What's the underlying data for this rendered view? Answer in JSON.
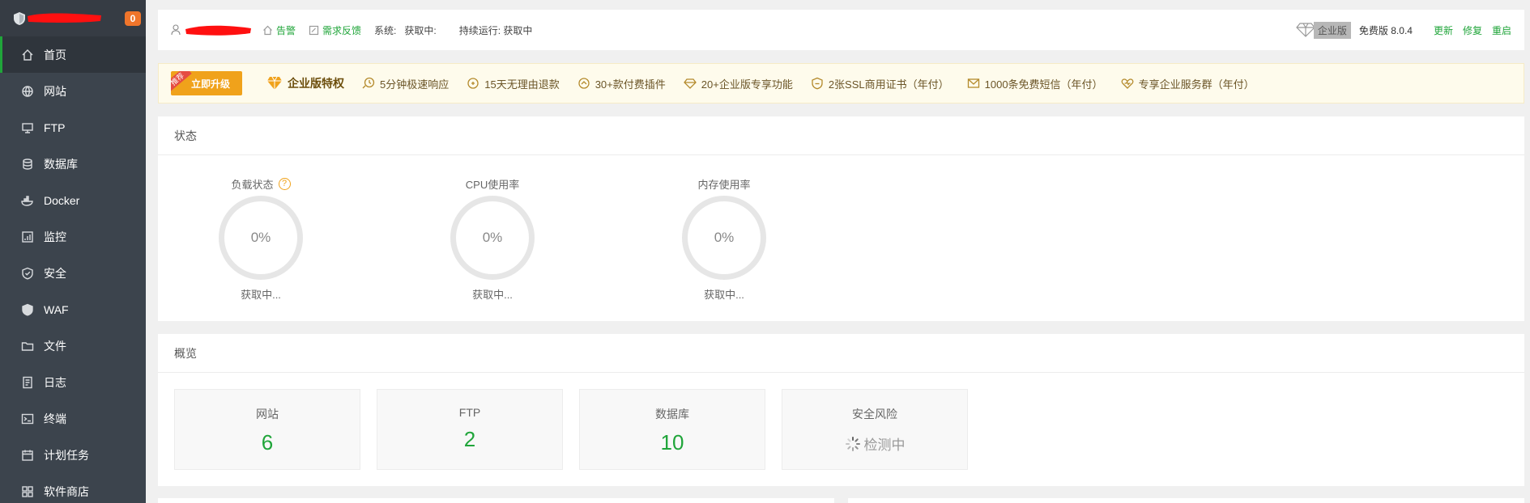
{
  "sidebar": {
    "badge_count": "0",
    "items": [
      {
        "label": "首页",
        "icon": "home-icon",
        "active": true
      },
      {
        "label": "网站",
        "icon": "globe-icon"
      },
      {
        "label": "FTP",
        "icon": "ftp-icon"
      },
      {
        "label": "数据库",
        "icon": "database-icon"
      },
      {
        "label": "Docker",
        "icon": "docker-icon"
      },
      {
        "label": "监控",
        "icon": "monitor-icon"
      },
      {
        "label": "安全",
        "icon": "shield-check-icon"
      },
      {
        "label": "WAF",
        "icon": "waf-shield-icon"
      },
      {
        "label": "文件",
        "icon": "folder-icon"
      },
      {
        "label": "日志",
        "icon": "log-icon"
      },
      {
        "label": "终端",
        "icon": "terminal-icon"
      },
      {
        "label": "计划任务",
        "icon": "calendar-icon"
      },
      {
        "label": "软件商店",
        "icon": "apps-icon"
      }
    ]
  },
  "topbar": {
    "alert_label": "告警",
    "feedback_label": "需求反馈",
    "system_label": "系统:",
    "system_value": "获取中:",
    "uptime_label": "持续运行: 获取中",
    "enterprise_label": "企业版",
    "free_version": "免费版 8.0.4",
    "update_label": "更新",
    "repair_label": "修复",
    "restart_label": "重启"
  },
  "promo": {
    "recommend_tag": "推荐",
    "upgrade_label": "立即升级",
    "privilege_label": "企业版特权",
    "features": [
      {
        "label": "5分钟极速响应",
        "icon": "fast-response-icon"
      },
      {
        "label": "15天无理由退款",
        "icon": "refund-icon"
      },
      {
        "label": "30+款付费插件",
        "icon": "plugin-icon"
      },
      {
        "label": "20+企业版专享功能",
        "icon": "diamond-icon"
      },
      {
        "label": "2张SSL商用证书（年付）",
        "icon": "ssl-icon"
      },
      {
        "label": "1000条免费短信（年付）",
        "icon": "mail-icon"
      },
      {
        "label": "专享企业服务群（年付）",
        "icon": "service-heart-icon"
      }
    ]
  },
  "status": {
    "title": "状态",
    "gauges": [
      {
        "title": "负载状态",
        "value": "0%",
        "state": "获取中...",
        "help": "?"
      },
      {
        "title": "CPU使用率",
        "value": "0%",
        "state": "获取中..."
      },
      {
        "title": "内存使用率",
        "value": "0%",
        "state": "获取中..."
      }
    ]
  },
  "overview": {
    "title": "概览",
    "cards": [
      {
        "label": "网站",
        "value": "6"
      },
      {
        "label": "FTP",
        "value": "2"
      },
      {
        "label": "数据库",
        "value": "10"
      },
      {
        "label": "安全风险",
        "checking": "检测中"
      }
    ]
  },
  "colors": {
    "accent_green": "#20a53a",
    "sidebar_bg": "#3c444d",
    "promo_orange": "#f0a21b",
    "badge_orange": "#f0752b"
  }
}
